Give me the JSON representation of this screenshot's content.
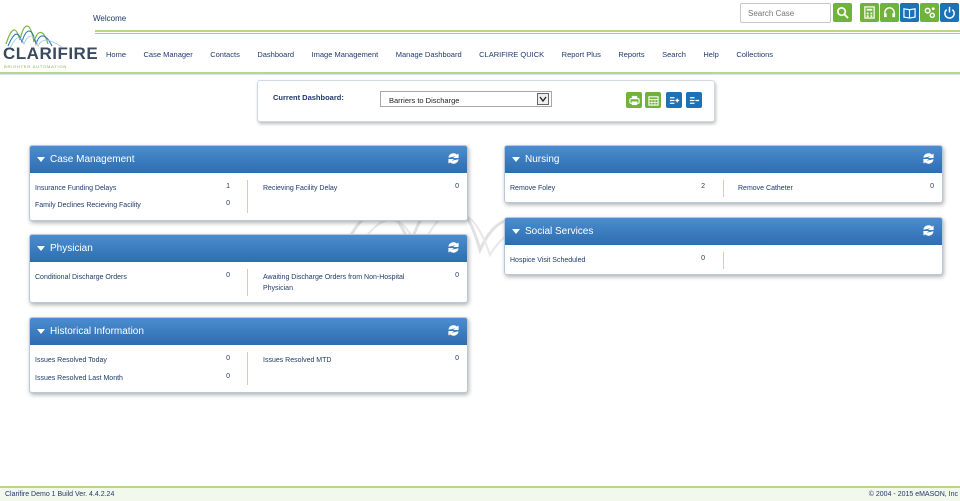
{
  "header": {
    "logo_text": "CLARIFIRE",
    "logo_tagline": "BRIGHTER AUTOMATION",
    "welcome": "Welcome",
    "search_placeholder": "Search Case"
  },
  "nav": [
    "Home",
    "Case Manager",
    "Contacts",
    "Dashboard",
    "Image Management",
    "Manage Dashboard",
    "CLARIFIRE QUICK",
    "Report Plus",
    "Reports",
    "Search",
    "Help",
    "Collections"
  ],
  "selector": {
    "label": "Current Dashboard:",
    "value": "Barriers to Discharge"
  },
  "panels": {
    "case_management": {
      "title": "Case Management",
      "items": [
        {
          "label": "Insurance Funding Delays",
          "count": "1"
        },
        {
          "label": "Recieving Facility Delay",
          "count": "0"
        },
        {
          "label": "Family Declines Recieving Facility",
          "count": "0"
        }
      ]
    },
    "physician": {
      "title": "Physician",
      "items": [
        {
          "label": "Conditional Discharge Orders",
          "count": "0"
        },
        {
          "label": "Awaiting Discharge Orders from Non-Hospital Physician",
          "count": "0"
        }
      ]
    },
    "historical": {
      "title": "Historical Information",
      "items": [
        {
          "label": "Issues Resolved Today",
          "count": "0"
        },
        {
          "label": "Issues Resolved MTD",
          "count": "0"
        },
        {
          "label": "Issues Resolved Last Month",
          "count": "0"
        }
      ]
    },
    "nursing": {
      "title": "Nursing",
      "items": [
        {
          "label": "Remove Foley",
          "count": "2"
        },
        {
          "label": "Remove Catheter",
          "count": "0"
        }
      ]
    },
    "social": {
      "title": "Social Services",
      "items": [
        {
          "label": "Hospice Visit Scheduled",
          "count": "0"
        }
      ]
    }
  },
  "footer": {
    "left": "Clarifire Demo 1   Build Ver. 4.4.2.24",
    "right": "©  2004 - 2015 eMASON, Inc"
  },
  "colors": {
    "accent_green": "#6fb33a",
    "accent_blue": "#1d72b6",
    "panel_header": "#3a7cc2",
    "text_navy": "#1f3a6b"
  }
}
